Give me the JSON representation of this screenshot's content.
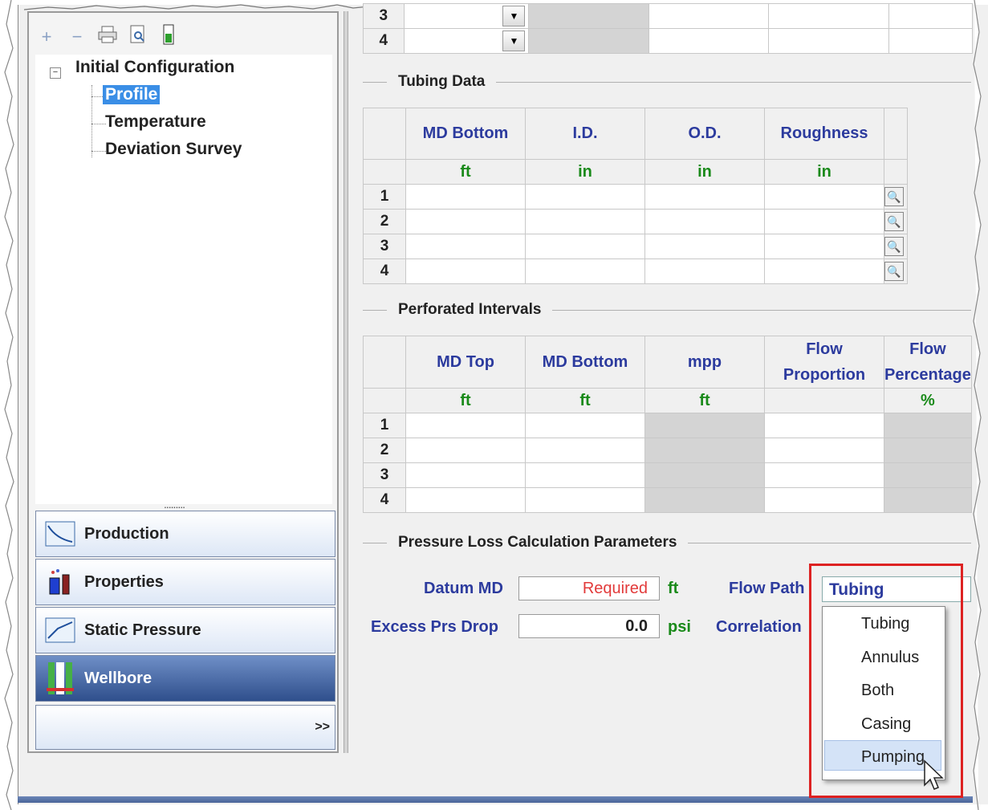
{
  "toolbar": {
    "add": "+",
    "remove": "−"
  },
  "tree": {
    "root": "Initial Configuration",
    "items": [
      "Profile",
      "Temperature",
      "Deviation Survey"
    ],
    "selected": "Profile",
    "grip": "........."
  },
  "nav": {
    "items": [
      {
        "label": "Production"
      },
      {
        "label": "Properties"
      },
      {
        "label": "Static Pressure"
      },
      {
        "label": "Wellbore"
      }
    ],
    "active": "Wellbore",
    "more": ">>"
  },
  "top_table": {
    "rows": [
      "3",
      "4"
    ]
  },
  "tubing": {
    "title": "Tubing Data",
    "columns": [
      "MD Bottom",
      "I.D.",
      "O.D.",
      "Roughness"
    ],
    "units": [
      "ft",
      "in",
      "in",
      "in"
    ],
    "rows": [
      "1",
      "2",
      "3",
      "4"
    ]
  },
  "perforated": {
    "title": "Perforated Intervals",
    "columns": [
      "MD Top",
      "MD Bottom",
      "mpp",
      "Flow Proportion",
      "Flow Percentage"
    ],
    "col4_line1": "Flow",
    "col4_line2": "Proportion",
    "col5_line1": "Flow",
    "col5_line2": "Percentage",
    "units": [
      "ft",
      "ft",
      "ft",
      "",
      "%"
    ],
    "rows": [
      "1",
      "2",
      "3",
      "4"
    ]
  },
  "pressure": {
    "title": "Pressure Loss Calculation Parameters",
    "datum_label": "Datum MD",
    "datum_value": "Required",
    "datum_unit": "ft",
    "excess_label": "Excess Prs Drop",
    "excess_value": "0.0",
    "excess_unit": "psi",
    "flow_path_label": "Flow Path",
    "flow_path_value": "Tubing",
    "correlation_label": "Correlation",
    "options": [
      "Tubing",
      "Annulus",
      "Both",
      "Casing",
      "Pumping"
    ],
    "hovered": "Pumping"
  },
  "colors": {
    "accent": "#3a8ee6",
    "header_text": "#2c3b9e",
    "unit_text": "#1a8a1a",
    "required_text": "#e23a3a",
    "highlight_box": "#dd2222"
  }
}
